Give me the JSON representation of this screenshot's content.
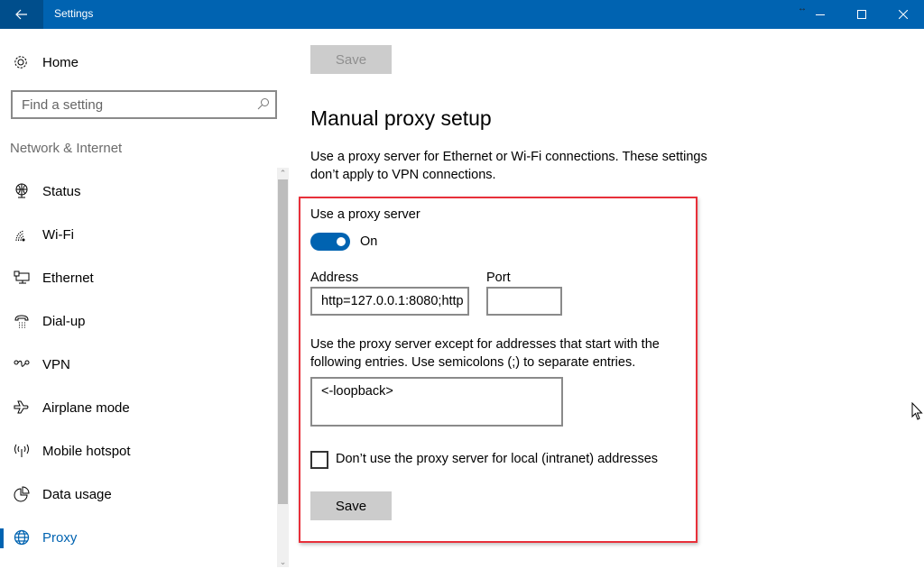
{
  "window": {
    "title": "Settings",
    "back_icon": "arrow-left-icon",
    "controls": [
      "minimize-icon",
      "maximize-icon",
      "close-icon"
    ]
  },
  "sidebar": {
    "home_label": "Home",
    "search_placeholder": "Find a setting",
    "section_title": "Network & Internet",
    "items": [
      {
        "label": "Status",
        "icon": "globe-monitor-icon",
        "active": false
      },
      {
        "label": "Wi-Fi",
        "icon": "wifi-icon",
        "active": false
      },
      {
        "label": "Ethernet",
        "icon": "ethernet-icon",
        "active": false
      },
      {
        "label": "Dial-up",
        "icon": "phone-icon",
        "active": false
      },
      {
        "label": "VPN",
        "icon": "vpn-icon",
        "active": false
      },
      {
        "label": "Airplane mode",
        "icon": "airplane-icon",
        "active": false
      },
      {
        "label": "Mobile hotspot",
        "icon": "hotspot-icon",
        "active": false
      },
      {
        "label": "Data usage",
        "icon": "pie-chart-icon",
        "active": false
      },
      {
        "label": "Proxy",
        "icon": "globe-icon",
        "active": true
      }
    ]
  },
  "main": {
    "top_save_label": "Save",
    "heading": "Manual proxy setup",
    "description": "Use a proxy server for Ethernet or Wi-Fi connections. These settings don’t apply to VPN connections.",
    "use_proxy_label": "Use a proxy server",
    "toggle_state": "On",
    "address_label": "Address",
    "address_value": "http=127.0.0.1:8080;http",
    "port_label": "Port",
    "port_value": "",
    "exceptions_label": "Use the proxy server except for addresses that start with the following entries. Use semicolons (;) to separate entries.",
    "exceptions_value": "<-loopback>",
    "local_checkbox_label": "Don’t use the proxy server for local (intranet) addresses",
    "local_checkbox_checked": false,
    "save_label": "Save"
  },
  "colors": {
    "accent": "#0063b1",
    "titlebar": "#0063b1",
    "highlight_border": "#e8303a"
  }
}
